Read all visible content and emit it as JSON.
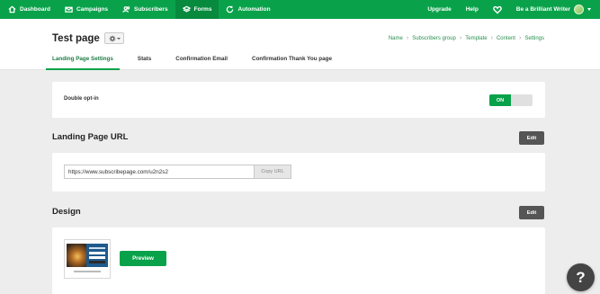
{
  "nav": {
    "items": [
      {
        "label": "Dashboard",
        "icon": "home-icon"
      },
      {
        "label": "Campaigns",
        "icon": "envelope-icon"
      },
      {
        "label": "Subscribers",
        "icon": "users-icon"
      },
      {
        "label": "Forms",
        "icon": "layers-icon"
      },
      {
        "label": "Automation",
        "icon": "refresh-icon"
      }
    ],
    "upgrade": "Upgrade",
    "help": "Help",
    "account": "Be a Brilliant Writer"
  },
  "header": {
    "title": "Test page",
    "breadcrumb": [
      "Name",
      "Subscribers group",
      "Template",
      "Content",
      "Settings"
    ],
    "tabs": [
      "Landing Page Settings",
      "Stats",
      "Confirmation Email",
      "Confirmation Thank You page"
    ]
  },
  "optin": {
    "label": "Double opt-in",
    "toggle": "ON"
  },
  "url_section": {
    "title": "Landing Page URL",
    "edit": "Edit",
    "url": "https://www.subscribepage.com/u2n2s2",
    "copy": "Copy URL"
  },
  "design_section": {
    "title": "Design",
    "edit": "Edit",
    "preview": "Preview"
  },
  "help_fab": "?",
  "colors": {
    "brand": "#09a24a",
    "dark_button": "#555555"
  }
}
